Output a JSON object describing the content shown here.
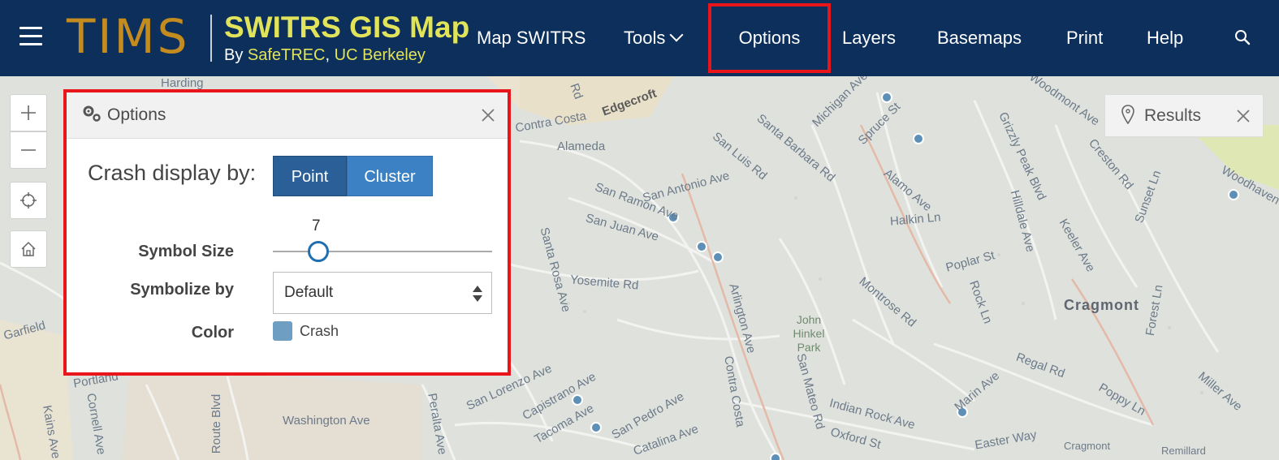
{
  "header": {
    "logo": "TIMS",
    "title": "SWITRS GIS Map",
    "subtitle_prefix": "By ",
    "subtitle_org1": "SafeTREC",
    "subtitle_sep": ", ",
    "subtitle_org2": "UC Berkeley",
    "nav": {
      "map_switrs": "Map SWITRS",
      "tools": "Tools",
      "options": "Options",
      "layers": "Layers",
      "basemaps": "Basemaps",
      "print": "Print",
      "help": "Help"
    }
  },
  "options_panel": {
    "title": "Options",
    "crash_display_label": "Crash display by:",
    "point_label": "Point",
    "cluster_label": "Cluster",
    "symbol_size_label": "Symbol Size",
    "symbol_size_value": "7",
    "symbolize_by_label": "Symbolize by",
    "symbolize_by_value": "Default",
    "color_label": "Color",
    "color_legend": "Crash"
  },
  "results": {
    "label": "Results"
  },
  "map_labels": {
    "harding": "Harding",
    "edgecroft": "Edgecroft",
    "rd": "Rd",
    "contra_costa": "Contra Costa",
    "alameda": "Alameda",
    "san_antonio": "San Antonio Ave",
    "san_luis": "San Luis Rd",
    "santa_barbara": "Santa Barbara Rd",
    "san_ramon": "San Ramon Ave",
    "san_juan": "San Juan Ave",
    "yosemite": "Yosemite Rd",
    "santa_rosa": "Santa Rosa Ave",
    "arlington": "Arlington Ave",
    "spruce": "Spruce St",
    "halkin": "Halkin Ln",
    "alamo": "Alamo Ave",
    "poplar": "Poplar St",
    "montrose": "Montrose Rd",
    "grizzly": "Grizzly Peak Blvd",
    "creston": "Creston Rd",
    "woodmont": "Woodmont Ave",
    "keeler": "Keeler Ave",
    "hilldale": "Hilldale Ave",
    "sunset": "Sunset Ln",
    "rock": "Rock Ln",
    "regal": "Regal Rd",
    "cragmont": "Cragmont",
    "garfield": "Garfield",
    "washington": "Washington Ave",
    "san_lorenzo": "San Lorenzo Ave",
    "capistrano": "Capistrano Ave",
    "tacoma": "Tacoma Ave",
    "san_pedro": "San Pedro Ave",
    "catalina": "Catalina Ave",
    "indian_rock": "Indian Rock Ave",
    "oxford": "Oxford St",
    "easter": "Easter Way",
    "marin": "Marin Ave",
    "san_mateo": "San Mateo Rd",
    "john_hinkel": "John Hinkel Park",
    "peralta": "Peralta Ave",
    "cornell": "Cornell Ave",
    "kains": "Kains Ave",
    "route": "Route Blvd",
    "portland": "Portland",
    "woodhaven": "Woodhaven",
    "remillard": "Remillard",
    "cragmont_small": "Cragmont",
    "miller": "Miller Ave",
    "poppy": "Poppy Ln",
    "forest": "Forest Ln",
    "michigan": "Michigan Ave",
    "contra_costa2": "Contra Costa"
  }
}
